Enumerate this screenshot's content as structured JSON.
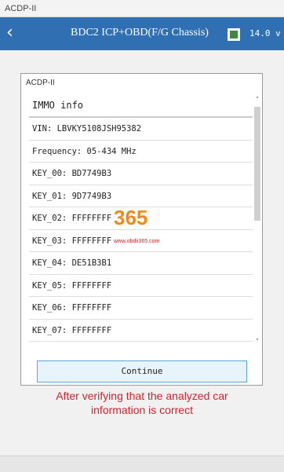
{
  "window": {
    "title": "ACDP-II"
  },
  "appbar": {
    "title": "BDC2 ICP+OBD(F/G Chassis)",
    "version": "14.0 v",
    "back_icon": "chevron-left-icon",
    "app_icon": "app-icon"
  },
  "dialog": {
    "title": "ACDP-II",
    "heading": "IMMO info",
    "rows": [
      "VIN: LBVKY5108JSH95382",
      "Frequency: 05-434 MHz",
      "KEY_00: BD7749B3",
      "KEY_01: 9D7749B3",
      "KEY_02: FFFFFFFF",
      "KEY_03: FFFFFFFF",
      "KEY_04: DE51B3B1",
      "KEY_05: FFFFFFFF",
      "KEY_06: FFFFFFFF",
      "KEY_07: FFFFFFFF"
    ],
    "continue_label": "Continue"
  },
  "caption": "After verifying that the analyzed car information is correct",
  "watermark": {
    "number": "365",
    "url": "www.obdii365.com"
  },
  "colors": {
    "appbar": "#2f6fb2",
    "caption": "#d2242a",
    "button_border": "#59a7d6"
  }
}
